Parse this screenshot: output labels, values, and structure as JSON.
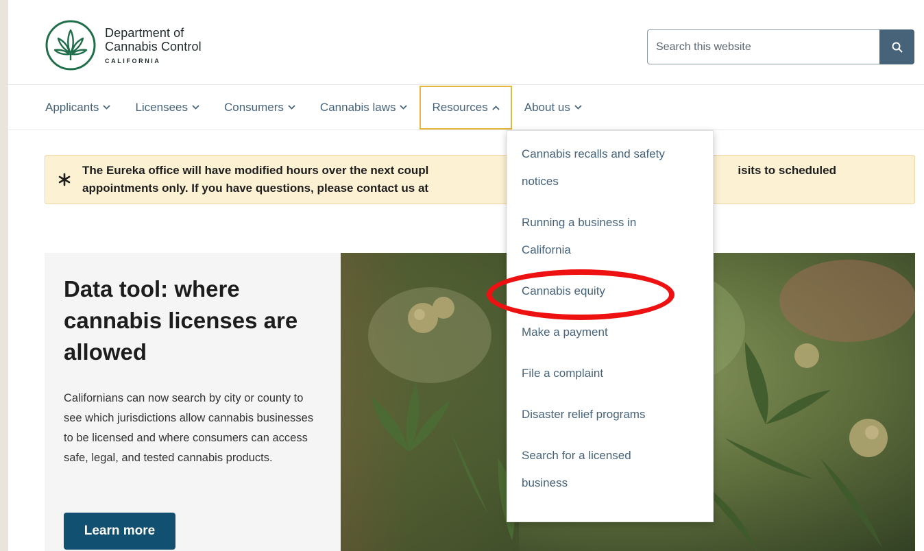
{
  "header": {
    "logo_line1": "Department of",
    "logo_line2": "Cannabis Control",
    "logo_sub": "CALIFORNIA",
    "search_placeholder": "Search this website"
  },
  "nav": {
    "items": [
      {
        "label": "Applicants"
      },
      {
        "label": "Licensees"
      },
      {
        "label": "Consumers"
      },
      {
        "label": "Cannabis laws"
      },
      {
        "label": "Resources",
        "expanded": true
      },
      {
        "label": "About us"
      }
    ]
  },
  "alert": {
    "text": "The Eureka office will have modified hours over the next coupl",
    "text_tail": "isits to scheduled",
    "text_line2": "appointments only. If you have questions, please contact us at"
  },
  "hero": {
    "title": "Data tool: where cannabis licenses are allowed",
    "body": "Californians can now search by city or county to see which jurisdictions allow cannabis businesses to be licensed and where consumers can access safe, legal, and tested cannabis products.",
    "button_label": "Learn more"
  },
  "resources_menu": {
    "items": [
      "Cannabis recalls and safety notices",
      "Running a business in California",
      "Cannabis equity",
      "Make a payment",
      "File a complaint",
      "Disaster relief programs",
      "Search for a licensed business"
    ],
    "highlighted_item": "Cannabis equity"
  },
  "colors": {
    "nav_text": "#46637a",
    "active_border": "#e5b842",
    "button": "#115070",
    "alert_bg": "#fdf1d3",
    "highlight": "#ee1111"
  },
  "icons": {
    "search": "magnifier-icon",
    "chevron": "chevron-down-icon",
    "chevron_up": "chevron-up-icon",
    "alert": "asterisk-icon"
  }
}
